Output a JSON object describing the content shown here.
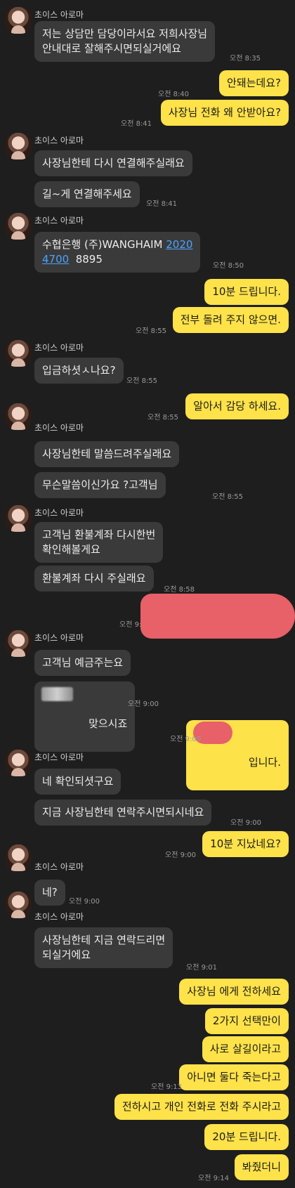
{
  "sender_name": "초이스 아로마",
  "messages": [
    {
      "text": "저는 상담만 담당이라서요 저희사장님\n안내대로 잘해주시면되실거에요",
      "time": "오전 8:35"
    },
    {
      "text": "안돼는데요?",
      "time": "오전 8:40"
    },
    {
      "text": "사장님 전화 왜 안받아요?",
      "time": "오전 8:41"
    },
    {
      "text": "사장님한테 다시 연결해주실래요"
    },
    {
      "text": "길~게 연결해주세요",
      "time": "오전 8:41"
    },
    {
      "bank": "수협은행 (주)WANGHAIM ",
      "acct1": "2020",
      "acct2": "4700",
      "acct3": "  8895",
      "time": "오전 8:50"
    },
    {
      "text": "10분 드립니다."
    },
    {
      "text": "전부 돌려 주지 않으면.",
      "time": "오전 8:55"
    },
    {
      "text": "입금하셧ㅅ나요?",
      "time": "오전 8:55"
    },
    {
      "text": "알아서 감당 하세요.",
      "time": "오전 8:55"
    },
    {
      "text": "사장님한테 말씀드려주실래요"
    },
    {
      "text": "무슨말씀이신가요 ?고객님",
      "time": "오전 8:55"
    },
    {
      "text": "고객님 환불계좌 다시한번\n확인해볼게요"
    },
    {
      "text": "환불계좌 다시 주실래요",
      "time": "오전 8:58"
    },
    {
      "time": "오전 9:00"
    },
    {
      "text": "고객님 예금주는요"
    },
    {
      "text": "맞으시죠",
      "time": "오전 9:00"
    },
    {
      "text": "입니다.",
      "time": "오전 9:00"
    },
    {
      "text": "네 확인되셧구요"
    },
    {
      "text": "지금 사장님한테 연락주시면되시네요",
      "time": "오전 9:00"
    },
    {
      "text": "10분 지났네요?",
      "time": "오전 9:00"
    },
    {
      "text": "네?",
      "time": "오전 9:00"
    },
    {
      "text": "사장님한테 지금 연락드리면\n되실거에요",
      "time": "오전 9:01"
    },
    {
      "text": "사장님 에게 전하세요"
    },
    {
      "text": "2가지 선택만이"
    },
    {
      "text": "사로 살길이라고"
    },
    {
      "text": "아니면 둘다 죽는다고",
      "time": "오전 9:13"
    },
    {
      "text": "전하시고 개인 전화로 전화 주시라고"
    },
    {
      "text": "20분 드립니다."
    },
    {
      "text": "봐줬더니",
      "time": "오전 9:14"
    }
  ],
  "colors": {
    "background": "#1e1e1e",
    "incoming": "#3a3a3a",
    "outgoing": "#fde24a",
    "link": "#4aa3ff"
  }
}
